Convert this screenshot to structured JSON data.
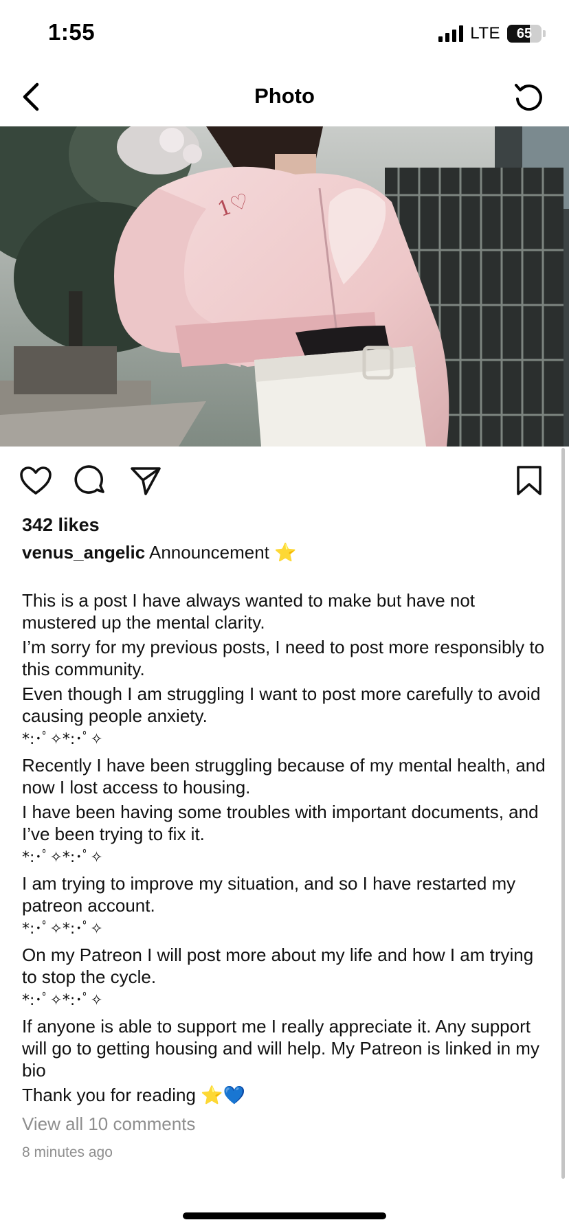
{
  "status_bar": {
    "time": "1:55",
    "network": "LTE",
    "battery_percent": "65",
    "battery_level": 0.65,
    "signal_bars_filled": 4
  },
  "nav": {
    "title": "Photo",
    "back_icon": "chevron-left-icon",
    "refresh_icon": "refresh-icon"
  },
  "photo": {
    "alt_subject": "person in pink cropped zip jacket"
  },
  "actions": {
    "like_icon": "heart-icon",
    "comment_icon": "comment-icon",
    "share_icon": "send-icon",
    "save_icon": "bookmark-icon"
  },
  "post": {
    "likes": "342 likes",
    "username": "venus_angelic",
    "caption_head": "Announcement ⭐",
    "lines": [
      "This is a post I have always wanted to make but have not mustered up the mental clarity.",
      "I’m sorry for my previous posts, I need to post more responsibly to this community.",
      "Even though I am struggling I want to post more carefully to avoid causing people anxiety.",
      "*:･ﾟ✧*:･ﾟ✧",
      "Recently I have been struggling because of my mental health, and now I lost access to housing.",
      "I have been having some troubles with important documents, and I’ve been trying to fix it.",
      "*:･ﾟ✧*:･ﾟ✧",
      "I am trying to improve my situation, and so I have restarted my patreon account.",
      "*:･ﾟ✧*:･ﾟ✧",
      "On my Patreon I will post more about my life and how I am trying to stop the cycle.",
      "*:･ﾟ✧*:･ﾟ✧",
      "If anyone is able to support me I really appreciate it. Any support will go to getting housing and will help. My Patreon is linked in my bio",
      "Thank you for reading ⭐💙"
    ],
    "view_comments": "View all 10 comments",
    "timestamp": "8 minutes ago"
  },
  "colors": {
    "text": "#111111",
    "muted": "#8e8e8e",
    "background": "#ffffff"
  }
}
